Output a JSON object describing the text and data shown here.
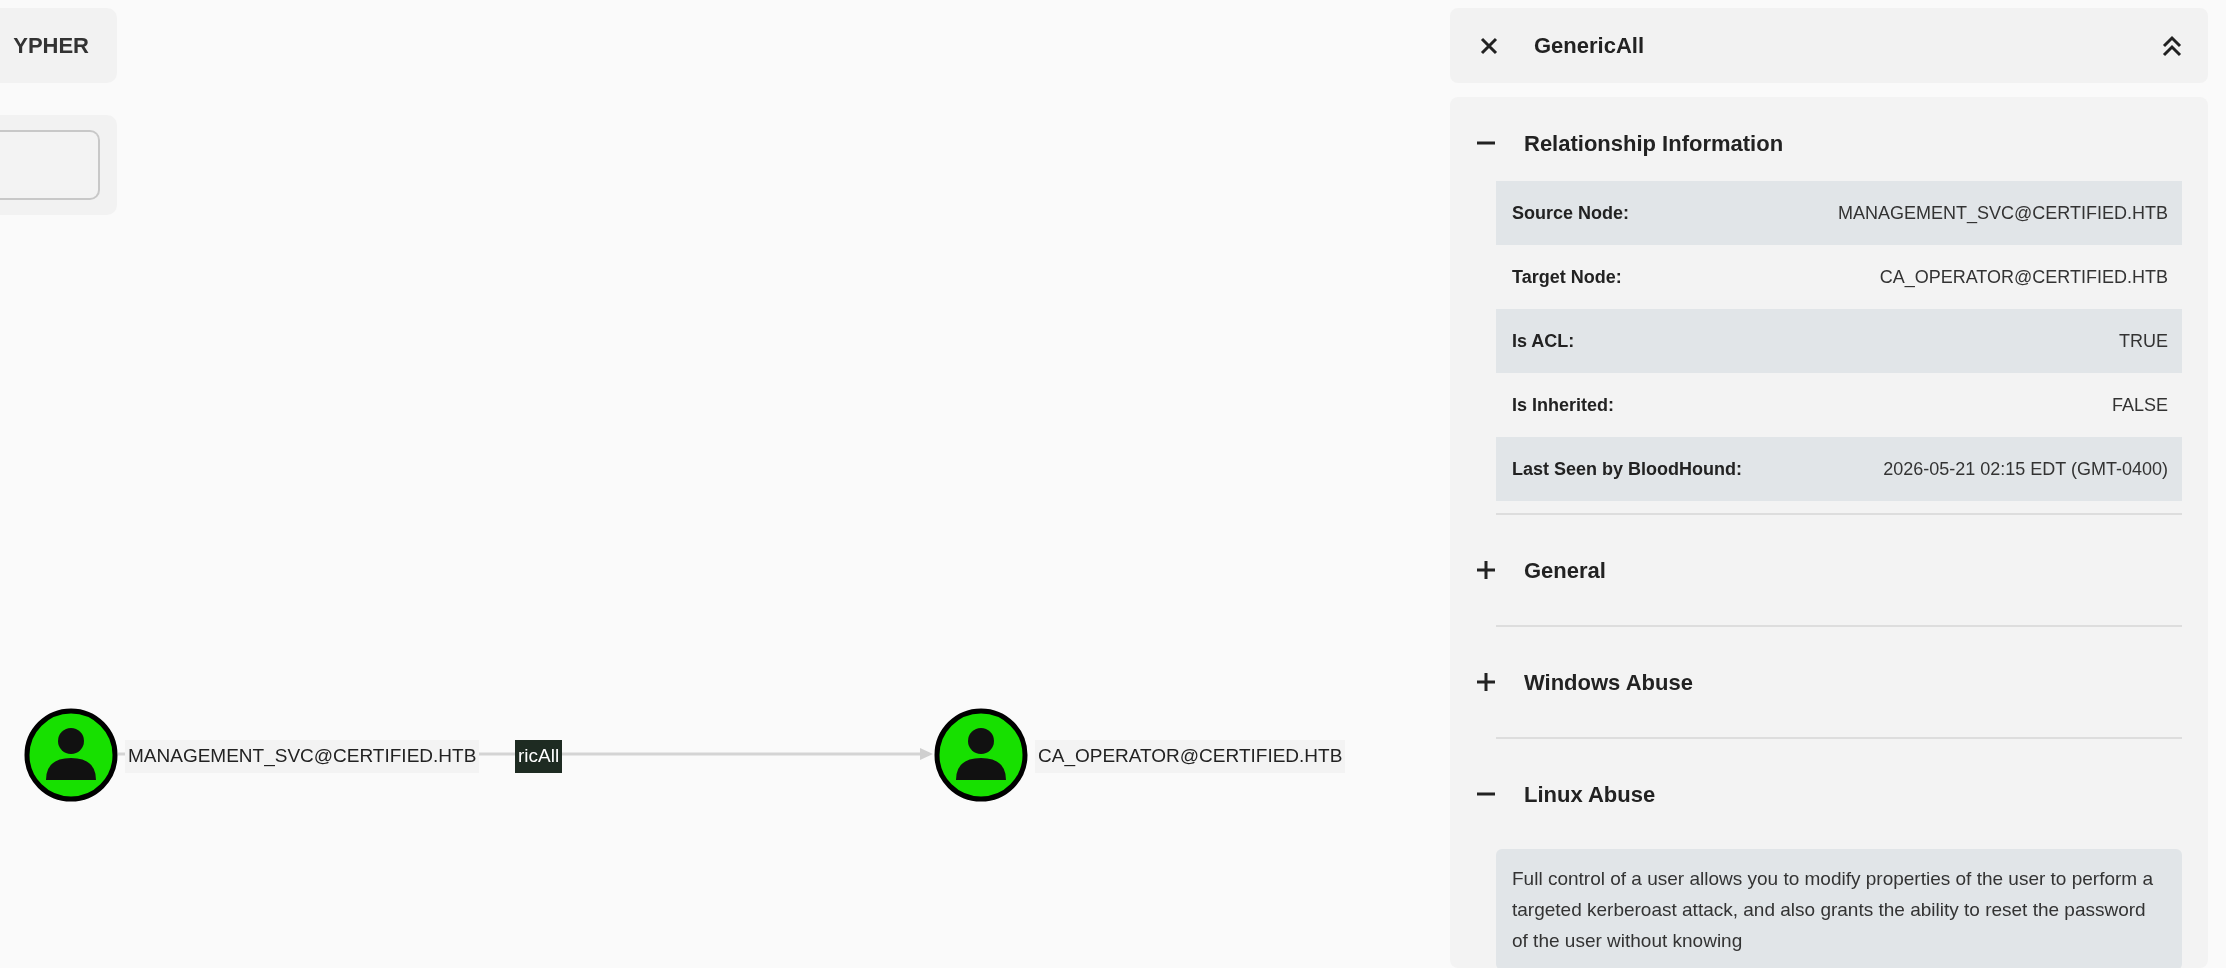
{
  "query_tab": {
    "label": "YPHER"
  },
  "graph": {
    "nodes": [
      {
        "label": "MANAGEMENT_SVC@CERTIFIED.HTB"
      },
      {
        "label": "CA_OPERATOR@CERTIFIED.HTB"
      }
    ],
    "edges": [
      {
        "label": "ricAll"
      }
    ]
  },
  "panel": {
    "title": "GenericAll",
    "sections": [
      {
        "title": "Relationship Information",
        "expanded": true,
        "rows": [
          {
            "label": "Source Node:",
            "value": "MANAGEMENT_SVC@CERTIFIED.HTB"
          },
          {
            "label": "Target Node:",
            "value": "CA_OPERATOR@CERTIFIED.HTB"
          },
          {
            "label": "Is ACL:",
            "value": "TRUE"
          },
          {
            "label": "Is Inherited:",
            "value": "FALSE"
          },
          {
            "label": "Last Seen by BloodHound:",
            "value": "2026-05-21 02:15 EDT (GMT-0400)"
          }
        ]
      },
      {
        "title": "General",
        "expanded": false
      },
      {
        "title": "Windows Abuse",
        "expanded": false
      },
      {
        "title": "Linux Abuse",
        "expanded": true,
        "text": "Full control of a user allows you to modify properties of the user to perform a targeted kerberoast attack, and also grants the ability to reset the password of the user without knowing"
      }
    ]
  }
}
